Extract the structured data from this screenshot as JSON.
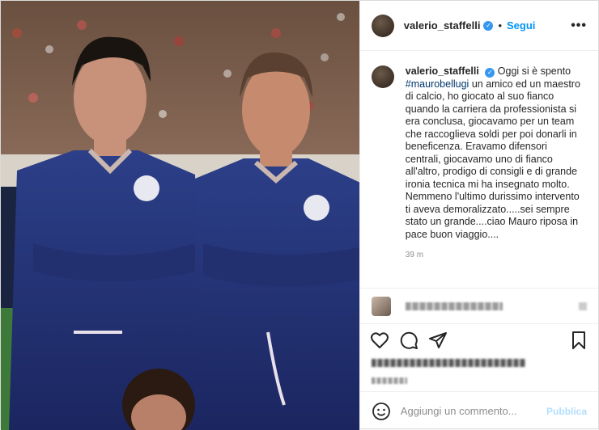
{
  "header": {
    "username": "valerio_staffelli",
    "verified_mark": "✓",
    "separator": "•",
    "follow_label": "Segui",
    "more_label": "•••"
  },
  "caption": {
    "username": "valerio_staffelli",
    "lead": " Oggi si è spento ",
    "hashtag": "#maurobellugi",
    "body": " un amico ed un maestro di calcio, ho giocato al suo fianco quando la carriera da professionista si era conclusa, giocavamo per un team che raccoglieva soldi per poi donarli in beneficenza. Eravamo difensori centrali, giocavamo uno di fianco all'altro, prodigo di consigli e di grande ironia tecnica mi ha insegnato molto. Nemmeno l'ultimo durissimo intervento ti aveva demoralizzato.....sei sempre stato un grande....ciao Mauro riposa in pace buon viaggio....",
    "time": "39 m"
  },
  "add_comment": {
    "placeholder": "Aggiungi un commento...",
    "publish_label": "Pubblica"
  },
  "colors": {
    "accent": "#0095f6",
    "verified": "#3897f0",
    "publish_disabled": "#b2dffc",
    "text": "#262626",
    "muted": "#8e8e8e"
  },
  "icons": {
    "like": "heart-icon",
    "comment": "comment-icon",
    "share": "share-icon",
    "save": "bookmark-icon",
    "emoji": "emoji-icon",
    "more": "more-icon"
  }
}
